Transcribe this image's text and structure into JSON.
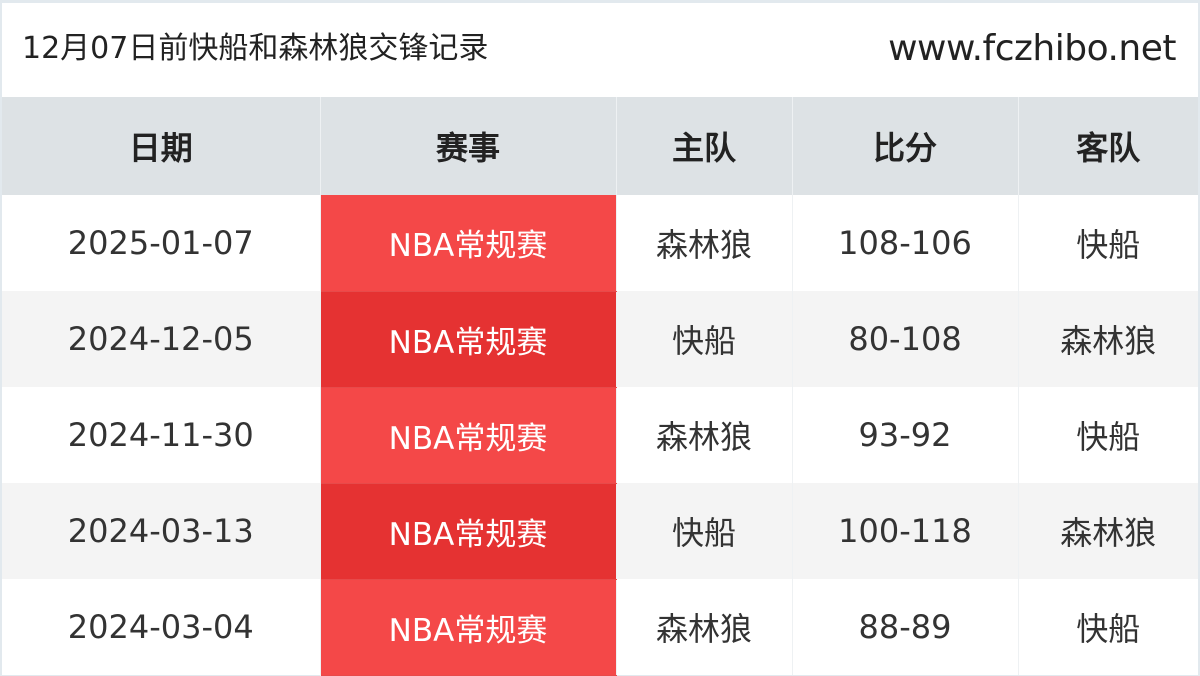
{
  "header": {
    "title": "12月07日前快船和森林狼交锋记录",
    "site": "www.fczhibo.net"
  },
  "table": {
    "columns": [
      "日期",
      "赛事",
      "主队",
      "比分",
      "客队"
    ],
    "rows": [
      {
        "date": "2025-01-07",
        "event": "NBA常规赛",
        "home": "森林狼",
        "score": "108-106",
        "away": "快船"
      },
      {
        "date": "2024-12-05",
        "event": "NBA常规赛",
        "home": "快船",
        "score": "80-108",
        "away": "森林狼"
      },
      {
        "date": "2024-11-30",
        "event": "NBA常规赛",
        "home": "森林狼",
        "score": "93-92",
        "away": "快船"
      },
      {
        "date": "2024-03-13",
        "event": "NBA常规赛",
        "home": "快船",
        "score": "100-118",
        "away": "森林狼"
      },
      {
        "date": "2024-03-04",
        "event": "NBA常规赛",
        "home": "森林狼",
        "score": "88-89",
        "away": "快船"
      }
    ]
  },
  "colors": {
    "event_cell_light": "#f44848",
    "event_cell_dark": "#e53232",
    "header_row": "#dde2e5"
  }
}
